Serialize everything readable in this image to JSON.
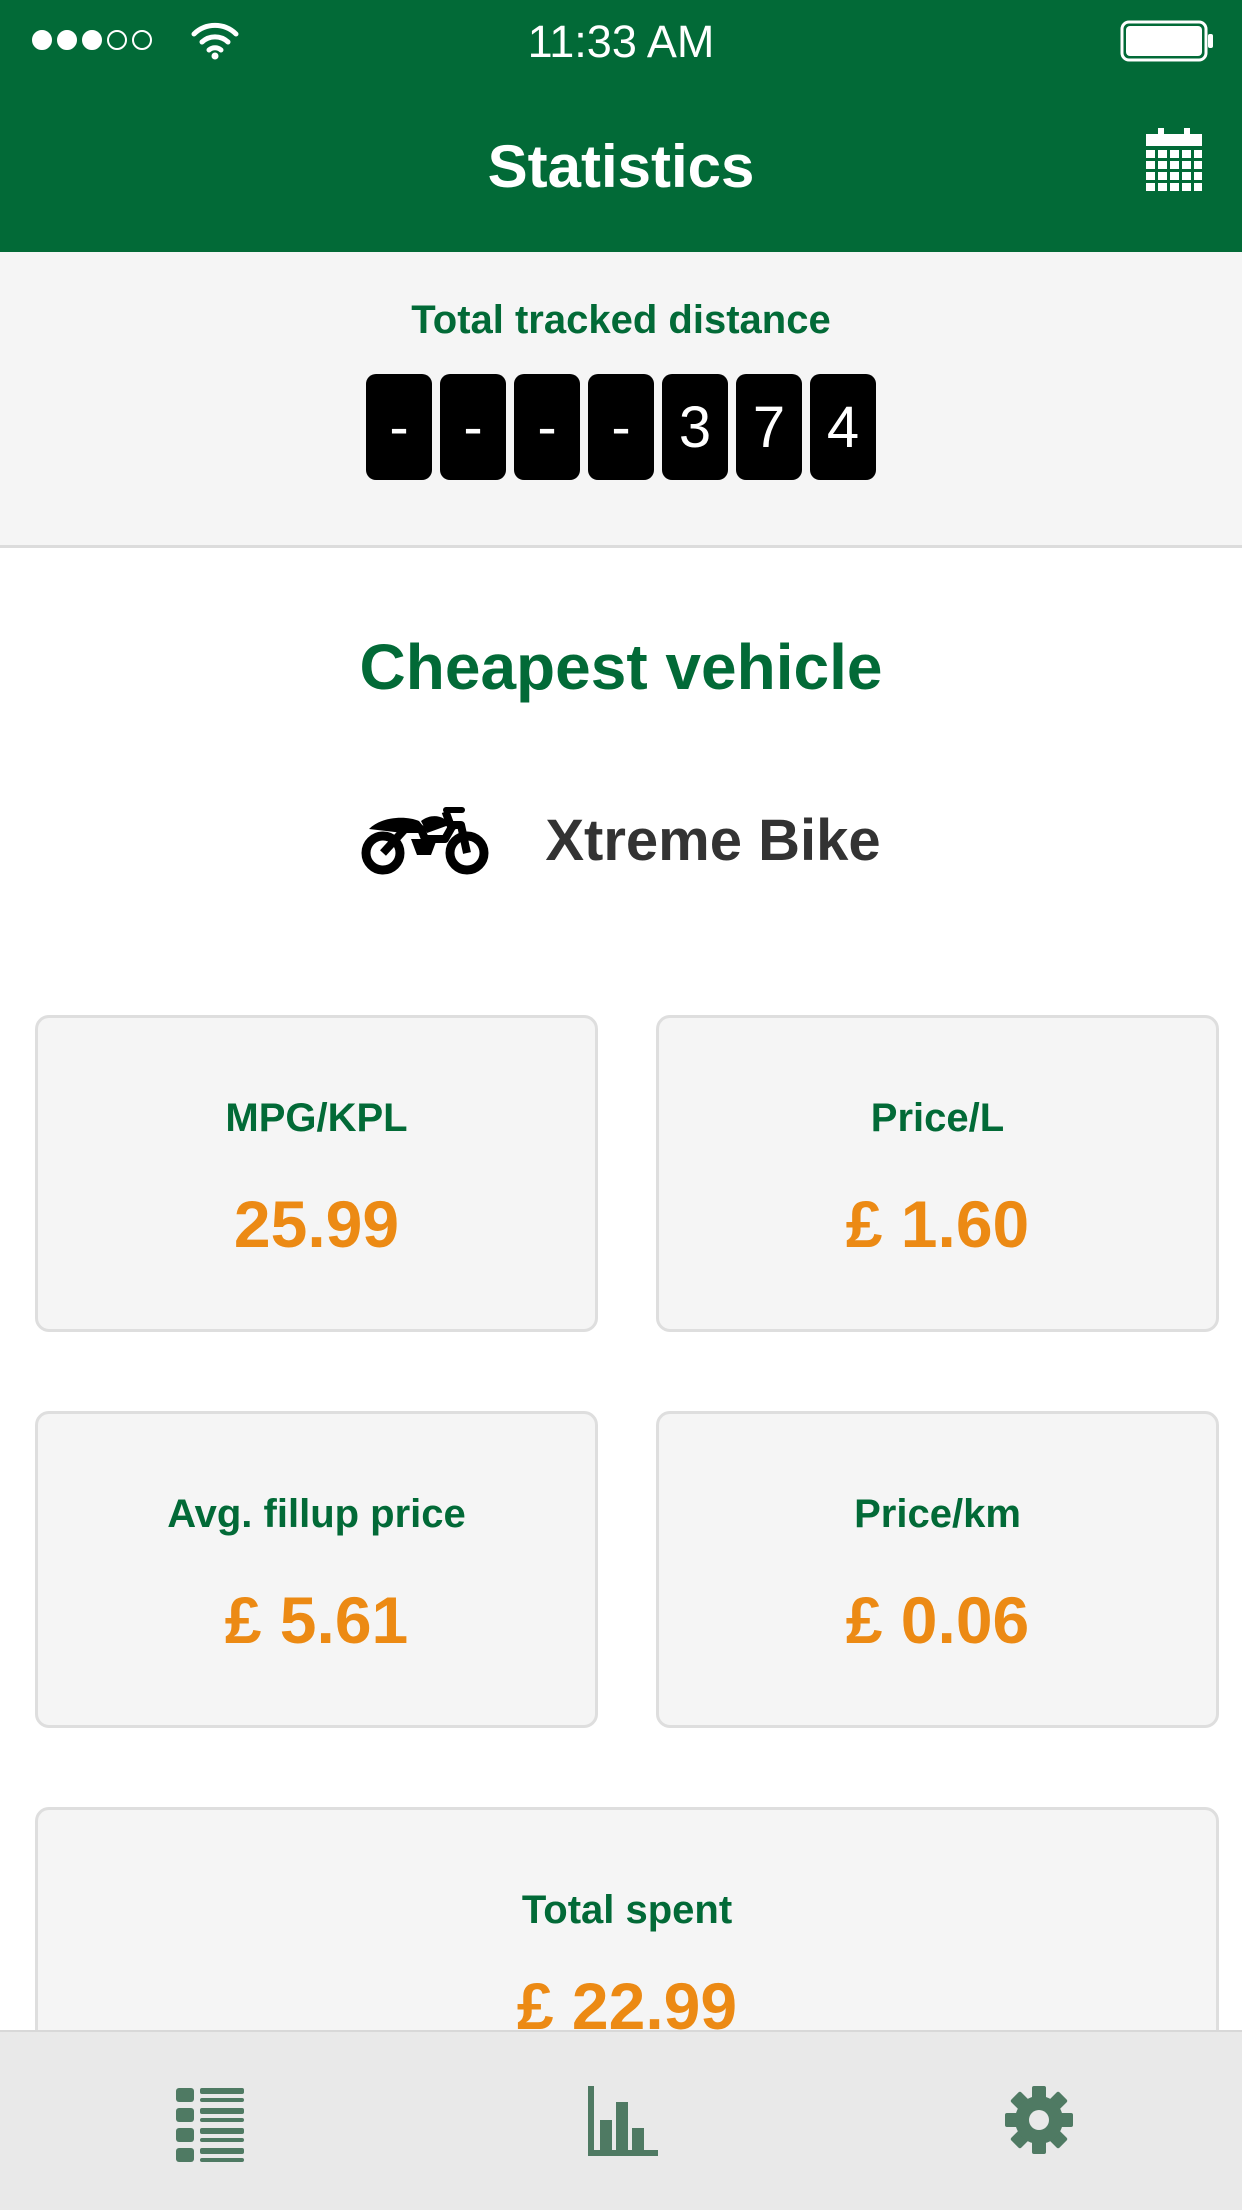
{
  "status_bar": {
    "time": "11:33 AM",
    "signal_bars": 5,
    "signal_filled": 3
  },
  "nav": {
    "title": "Statistics",
    "right_icon": "calendar-icon"
  },
  "distance": {
    "label": "Total tracked distance",
    "digits": [
      "-",
      "-",
      "-",
      "-",
      "3",
      "7",
      "4"
    ]
  },
  "cheapest": {
    "title": "Cheapest vehicle",
    "vehicle_icon": "motorcycle-icon",
    "vehicle_name": "Xtreme Bike"
  },
  "stats": [
    {
      "label": "MPG/KPL",
      "value": "25.99"
    },
    {
      "label": "Price/L",
      "value": "£ 1.60"
    },
    {
      "label": "Avg. fillup price",
      "value": "£ 5.61"
    },
    {
      "label": "Price/km",
      "value": "£ 0.06"
    },
    {
      "label": "Total spent",
      "value": "£ 22.99"
    }
  ],
  "tabs": [
    {
      "icon": "list-icon",
      "active": false
    },
    {
      "icon": "bar-chart-icon",
      "active": true
    },
    {
      "icon": "gear-icon",
      "active": false
    }
  ],
  "colors": {
    "brand": "#026a37",
    "accent": "#ec8a14",
    "tab_icon": "#4f7a63"
  }
}
